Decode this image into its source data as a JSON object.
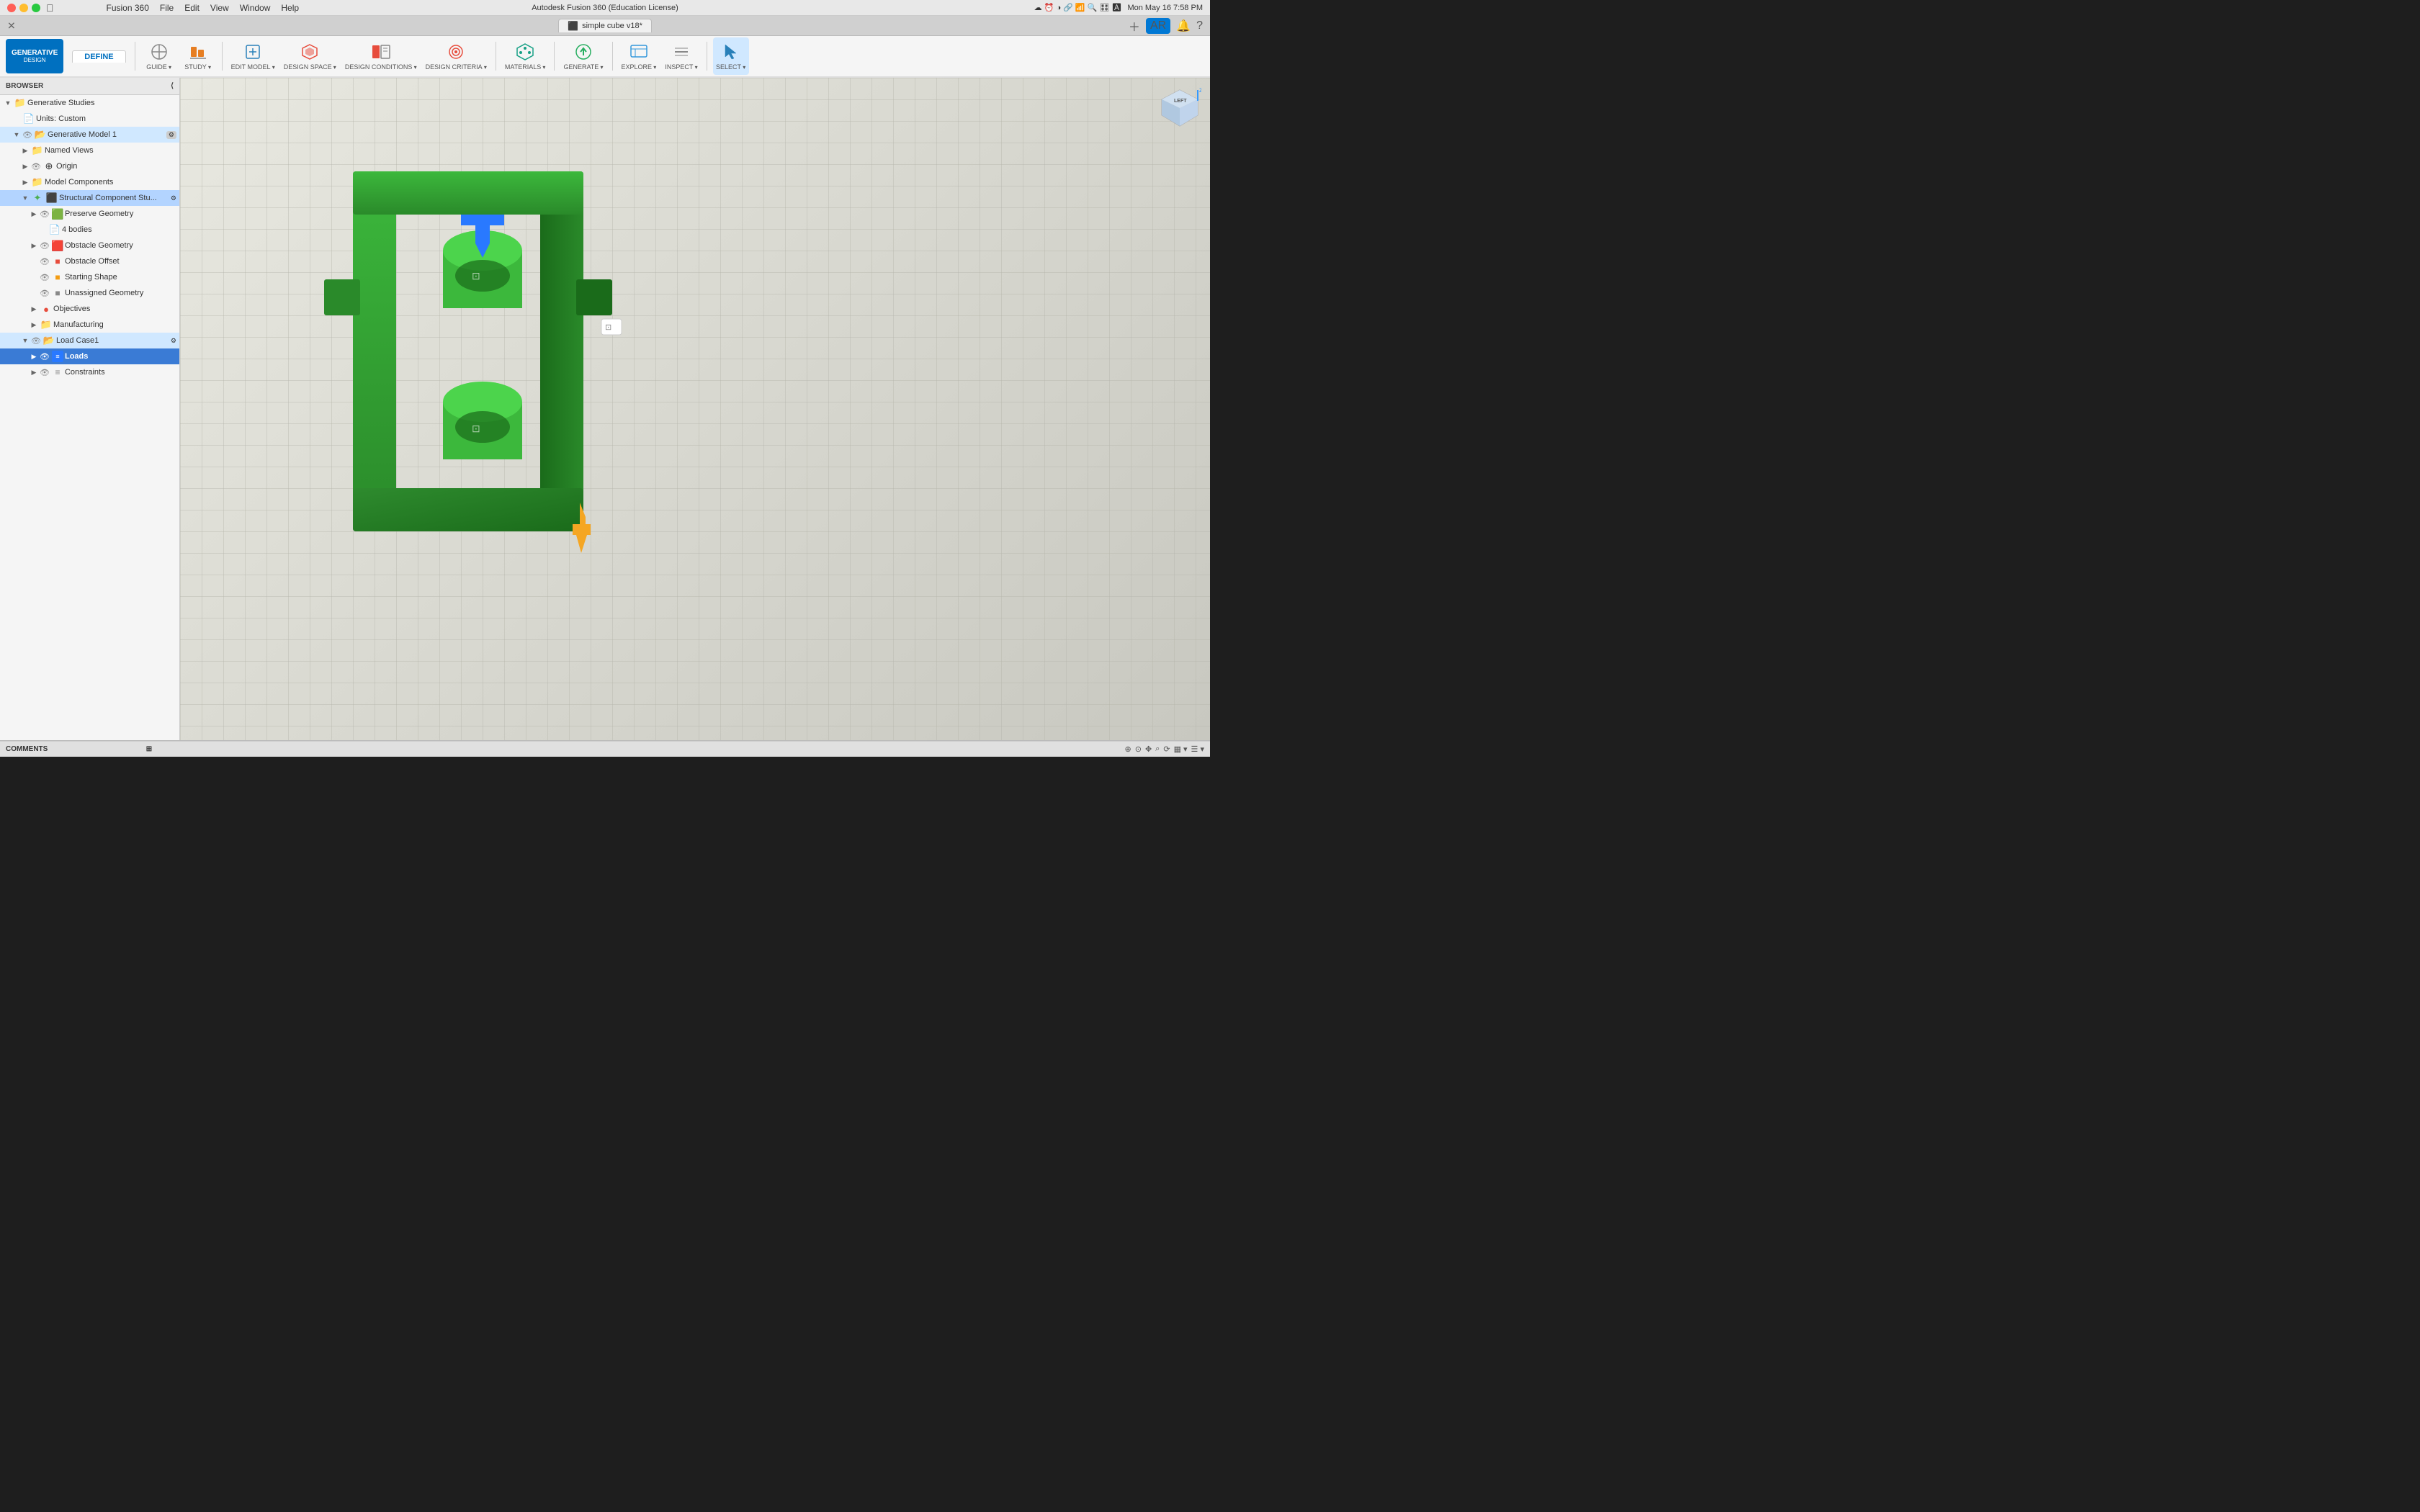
{
  "titlebar": {
    "title": "Autodesk Fusion 360 (Education License)",
    "tab_title": "simple cube v18*",
    "time": "Mon May 16  7:58 PM",
    "menu": [
      "Fusion 360",
      "File",
      "Edit",
      "View",
      "Window",
      "Help"
    ]
  },
  "toolbar": {
    "generative_design_label": "GENERATIVE",
    "generative_design_sub": "DESIGN",
    "tabs": [
      "DEFINE"
    ],
    "tools": [
      {
        "label": "GUIDE",
        "icon": "⊕"
      },
      {
        "label": "STUDY",
        "icon": "📊"
      },
      {
        "label": "EDIT MODEL",
        "icon": "✏️"
      },
      {
        "label": "DESIGN SPACE",
        "icon": "⬡"
      },
      {
        "label": "DESIGN CONDITIONS",
        "icon": "⚙"
      },
      {
        "label": "DESIGN CRITERIA",
        "icon": "🎯"
      },
      {
        "label": "MATERIALS",
        "icon": "🔬"
      },
      {
        "label": "GENERATE",
        "icon": "▶"
      },
      {
        "label": "EXPLORE",
        "icon": "🔍"
      },
      {
        "label": "INSPECT",
        "icon": "📐"
      },
      {
        "label": "SELECT",
        "icon": "↖"
      }
    ]
  },
  "browser": {
    "title": "BROWSER",
    "items": [
      {
        "id": "generative-studies",
        "label": "Generative Studies",
        "indent": 0,
        "expanded": true,
        "icon": "folder",
        "has_eye": false
      },
      {
        "id": "units",
        "label": "Units: Custom",
        "indent": 1,
        "expanded": false,
        "icon": "page",
        "has_eye": false
      },
      {
        "id": "generative-model-1",
        "label": "Generative Model 1",
        "indent": 1,
        "expanded": true,
        "icon": "blue-folder",
        "has_eye": true,
        "highlighted": true
      },
      {
        "id": "named-views",
        "label": "Named Views",
        "indent": 2,
        "expanded": false,
        "icon": "folder",
        "has_eye": false
      },
      {
        "id": "origin",
        "label": "Origin",
        "indent": 2,
        "expanded": false,
        "icon": "origin",
        "has_eye": true
      },
      {
        "id": "model-components",
        "label": "Model Components",
        "indent": 2,
        "expanded": false,
        "icon": "folder",
        "has_eye": false
      },
      {
        "id": "structural-component",
        "label": "Structural Component Stu...",
        "indent": 2,
        "expanded": true,
        "icon": "component",
        "has_eye": false,
        "selected": true
      },
      {
        "id": "preserve-geometry",
        "label": "Preserve Geometry",
        "indent": 3,
        "expanded": false,
        "icon": "green-shape",
        "has_eye": true
      },
      {
        "id": "4-bodies",
        "label": "4 bodies",
        "indent": 4,
        "expanded": false,
        "icon": "page",
        "has_eye": false
      },
      {
        "id": "obstacle-geometry",
        "label": "Obstacle Geometry",
        "indent": 3,
        "expanded": false,
        "icon": "red-shape",
        "has_eye": true
      },
      {
        "id": "obstacle-offset",
        "label": "Obstacle Offset",
        "indent": 3,
        "expanded": false,
        "icon": "red-box",
        "has_eye": true
      },
      {
        "id": "starting-shape",
        "label": "Starting Shape",
        "indent": 3,
        "expanded": false,
        "icon": "yellow-shape",
        "has_eye": true
      },
      {
        "id": "unassigned-geometry",
        "label": "Unassigned Geometry",
        "indent": 3,
        "expanded": false,
        "icon": "gray-box",
        "has_eye": true
      },
      {
        "id": "objectives",
        "label": "Objectives",
        "indent": 3,
        "expanded": false,
        "icon": "red-circle",
        "has_eye": false
      },
      {
        "id": "manufacturing",
        "label": "Manufacturing",
        "indent": 3,
        "expanded": false,
        "icon": "folder",
        "has_eye": false
      },
      {
        "id": "load-case-1",
        "label": "Load Case1",
        "indent": 2,
        "expanded": true,
        "icon": "blue-folder",
        "has_eye": true,
        "load_case": true
      },
      {
        "id": "loads",
        "label": "Loads",
        "indent": 3,
        "expanded": false,
        "icon": "blue-bar",
        "has_eye": true,
        "highlighted_blue": true
      },
      {
        "id": "constraints",
        "label": "Constraints",
        "indent": 3,
        "expanded": false,
        "icon": "gray-bar",
        "has_eye": true
      }
    ]
  },
  "viewport": {
    "axis_label": "LEFT"
  },
  "statusbar": {
    "comments_label": "COMMENTS",
    "left_tools": [
      "magnet",
      "snap",
      "move",
      "zoom",
      "view-cube",
      "render"
    ],
    "right_tools": []
  }
}
